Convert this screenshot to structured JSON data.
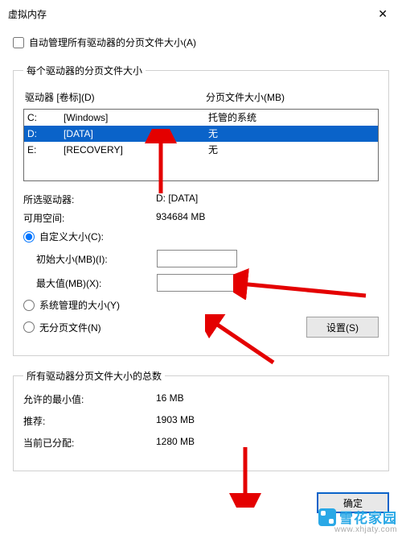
{
  "title": "虚拟内存",
  "auto_manage_label": "自动管理所有驱动器的分页文件大小(A)",
  "group_drives_legend": "每个驱动器的分页文件大小",
  "col_drive": "驱动器 [卷标](D)",
  "col_size": "分页文件大小(MB)",
  "drives": [
    {
      "letter": "C:",
      "label": "[Windows]",
      "size": "托管的系统"
    },
    {
      "letter": "D:",
      "label": "[DATA]",
      "size": "无"
    },
    {
      "letter": "E:",
      "label": "[RECOVERY]",
      "size": "无"
    }
  ],
  "selected_drive_label": "所选驱动器:",
  "selected_drive_value": "D:  [DATA]",
  "free_space_label": "可用空间:",
  "free_space_value": "934684 MB",
  "custom_size_label": "自定义大小(C):",
  "initial_size_label": "初始大小(MB)(I):",
  "initial_size_value": "",
  "max_size_label": "最大值(MB)(X):",
  "max_size_value": "",
  "system_managed_label": "系统管理的大小(Y)",
  "no_paging_label": "无分页文件(N)",
  "set_button": "设置(S)",
  "group_totals_legend": "所有驱动器分页文件大小的总数",
  "min_allowed_label": "允许的最小值:",
  "min_allowed_value": "16 MB",
  "recommended_label": "推荐:",
  "recommended_value": "1903 MB",
  "current_label": "当前已分配:",
  "current_value": "1280 MB",
  "ok_button": "确定",
  "watermark_name": "雪花家园",
  "watermark_url": "www.xhjaty.com"
}
